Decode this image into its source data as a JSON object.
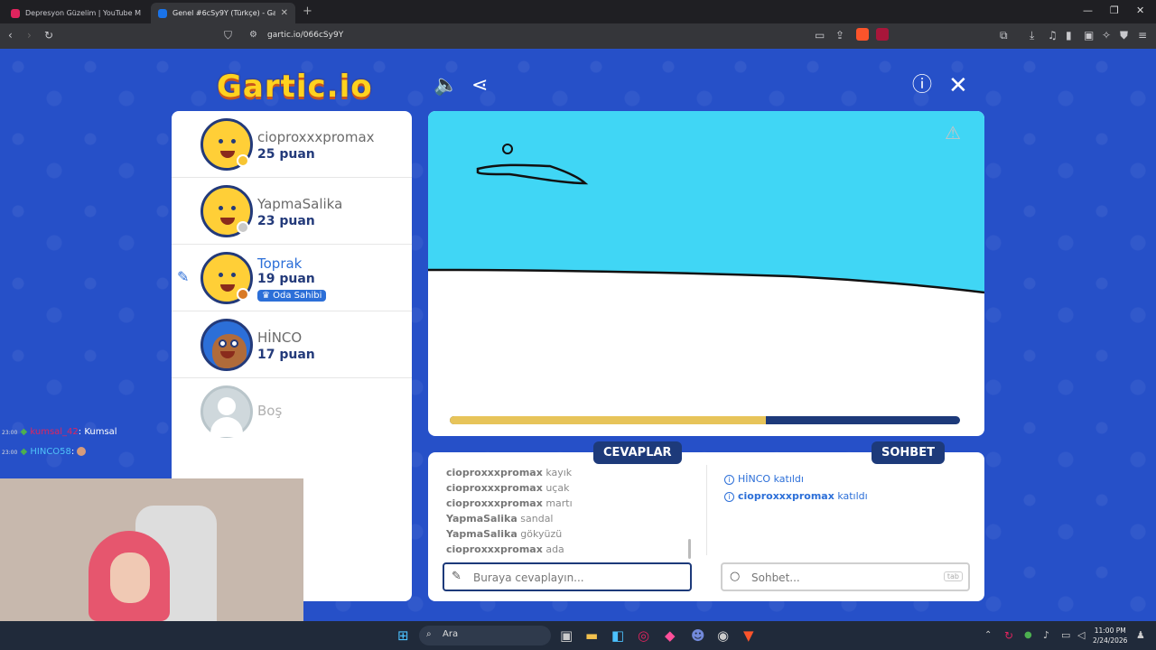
{
  "browser": {
    "tabs": [
      {
        "title": "Depresyon Güzelim | YouTube M",
        "favicon_color": "#e0245e"
      },
      {
        "title": "Genel #6cSy9Y (Türkçe) - Gartic.io",
        "favicon_color": "#1a73e8"
      }
    ],
    "url": "gartic.io/066cSy9Y"
  },
  "game": {
    "logo": "Gartic.io",
    "players": [
      {
        "name": "cioproxxxpromax",
        "score": "25 puan",
        "dot_color": "#f7c533"
      },
      {
        "name": "YapmaSalika",
        "score": "23 puan",
        "dot_color": "#c9c9c9"
      },
      {
        "name": "Toprak",
        "score": "19 puan",
        "dot_color": "#d97a26",
        "badge": "Oda Sahibi"
      },
      {
        "name": "HİNCO",
        "score": "17 puan",
        "dot_color": ""
      }
    ],
    "empty_slot": "Boş",
    "timer_fraction": 0.62,
    "answers_tab": "CEVAPLAR",
    "chat_tab": "SOHBET",
    "guesses": [
      {
        "user": "cioproxxxpromax",
        "text": "kayık"
      },
      {
        "user": "cioproxxxpromax",
        "text": "uçak"
      },
      {
        "user": "cioproxxxpromax",
        "text": "martı"
      },
      {
        "user": "YapmaSalika",
        "text": "sandal"
      },
      {
        "user": "YapmaSalika",
        "text": "gökyüzü"
      },
      {
        "user": "cioproxxxpromax",
        "text": "ada"
      }
    ],
    "chat_messages": [
      {
        "user": "HİNCO",
        "text": "katıldı"
      },
      {
        "user": "cioproxxxpromax",
        "text": "katıldı"
      }
    ],
    "answer_placeholder": "Buraya cevaplayın...",
    "chat_placeholder": "Sohbet...",
    "tab_key": "tab"
  },
  "overlay": {
    "messages": [
      {
        "time": "23:00",
        "user": "kumsal_42",
        "text": ": Kumsal",
        "user_color": "#e0245e"
      },
      {
        "time": "23:00",
        "user": "HINCO58",
        "text": ":",
        "user_color": "#4fc3f7"
      }
    ]
  },
  "taskbar": {
    "search_label": "Ara",
    "time": "11:00 PM",
    "date": "2/24/2026"
  }
}
